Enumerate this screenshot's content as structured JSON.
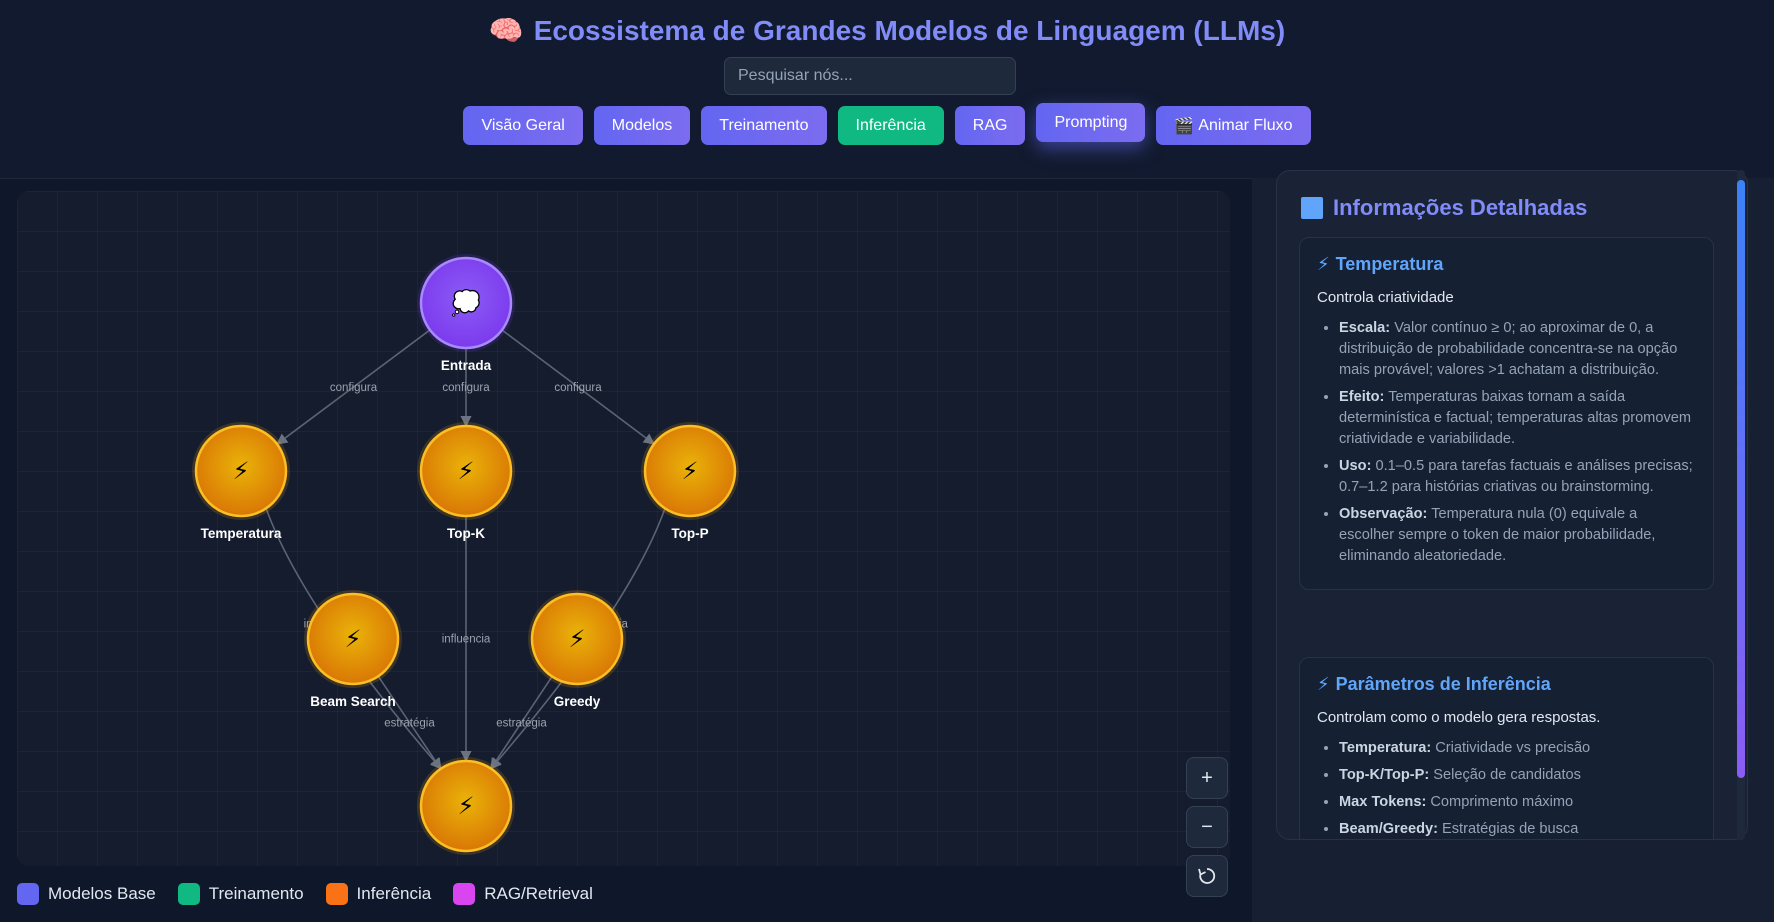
{
  "header": {
    "title_icon": "brain-emoji",
    "title": "Ecossistema de Grandes Modelos de Linguagem (LLMs)",
    "search_placeholder": "Pesquisar nós...",
    "buttons": [
      {
        "label": "Visão Geral"
      },
      {
        "label": "Modelos"
      },
      {
        "label": "Treinamento"
      },
      {
        "label": "Inferência"
      },
      {
        "label": "RAG"
      },
      {
        "label": "Prompting"
      },
      {
        "label": "Animar Fluxo",
        "icon": "clapper-icon"
      }
    ],
    "active_button": "Prompting"
  },
  "graph": {
    "nodes": [
      {
        "id": "entrada",
        "label": "Entrada",
        "icon": "speech-bubble-icon",
        "color": "#7c3aed"
      },
      {
        "id": "temperatura",
        "label": "Temperatura",
        "icon": "lightning-icon",
        "color": "#f59e0b"
      },
      {
        "id": "topk",
        "label": "Top-K",
        "icon": "lightning-icon",
        "color": "#f59e0b"
      },
      {
        "id": "topp",
        "label": "Top-P",
        "icon": "lightning-icon",
        "color": "#f59e0b"
      },
      {
        "id": "beam",
        "label": "Beam Search",
        "icon": "lightning-icon",
        "color": "#f59e0b"
      },
      {
        "id": "greedy",
        "label": "Greedy",
        "icon": "lightning-icon",
        "color": "#f59e0b"
      },
      {
        "id": "saida",
        "label": "",
        "icon": "lightning-icon",
        "color": "#f59e0b"
      }
    ],
    "edges": [
      {
        "from": "entrada",
        "to": "temperatura",
        "label": "configura"
      },
      {
        "from": "entrada",
        "to": "topk",
        "label": "configura"
      },
      {
        "from": "entrada",
        "to": "topp",
        "label": "configura"
      },
      {
        "from": "temperatura",
        "to": "saida",
        "label": "influencia"
      },
      {
        "from": "topk",
        "to": "saida",
        "label": "influencia"
      },
      {
        "from": "topp",
        "to": "saida",
        "label": "influencia"
      },
      {
        "from": "beam",
        "to": "saida",
        "label": "estratégia"
      },
      {
        "from": "greedy",
        "to": "saida",
        "label": "estratégia"
      }
    ]
  },
  "zoom_controls": {
    "zoom_in": "+",
    "zoom_out": "−",
    "reset_icon": "reset-icon"
  },
  "legend": [
    {
      "label": "Modelos Base",
      "color": "#6366f1"
    },
    {
      "label": "Treinamento",
      "color": "#10b981"
    },
    {
      "label": "Inferência",
      "color": "#f97316"
    },
    {
      "label": "RAG/Retrieval",
      "color": "#d946ef"
    }
  ],
  "panel": {
    "title": "Informações Detalhadas",
    "cards": [
      {
        "title": "Temperatura",
        "description": "Controla criatividade",
        "items": [
          {
            "term": "Escala:",
            "text": "Valor contínuo ≥ 0; ao aproximar de 0, a distribuição de probabilidade concentra-se na opção mais provável; valores >1 achatam a distribuição."
          },
          {
            "term": "Efeito:",
            "text": "Temperaturas baixas tornam a saída determinística e factual; temperaturas altas promovem criatividade e variabilidade."
          },
          {
            "term": "Uso:",
            "text": "0.1–0.5 para tarefas factuais e análises precisas; 0.7–1.2 para histórias criativas ou brainstorming."
          },
          {
            "term": "Observação:",
            "text": "Temperatura nula (0) equivale a escolher sempre o token de maior probabilidade, eliminando aleatoriedade."
          }
        ]
      },
      {
        "title": "Parâmetros de Inferência",
        "description": "Controlam como o modelo gera respostas.",
        "items": [
          {
            "term": "Temperatura:",
            "text": "Criatividade vs precisão"
          },
          {
            "term": "Top-K/Top-P:",
            "text": "Seleção de candidatos"
          },
          {
            "term": "Max Tokens:",
            "text": "Comprimento máximo"
          },
          {
            "term": "Beam/Greedy:",
            "text": "Estratégias de busca"
          }
        ]
      }
    ]
  }
}
